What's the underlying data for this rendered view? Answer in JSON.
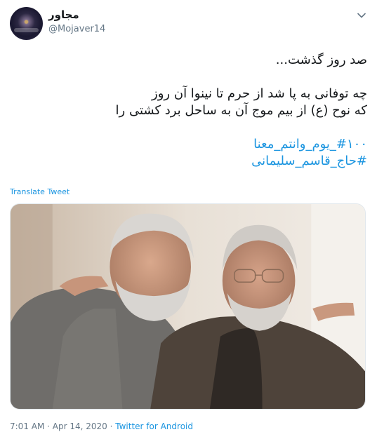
{
  "author": {
    "display_name": "مجاور",
    "handle": "@Mojaver14",
    "avatar_icon": "avatar-image"
  },
  "tweet": {
    "lines": [
      "صد روز گذشت...",
      "",
      "چه توفانی به پا شد از حرم تا نینوا آن روز",
      "که نوح (ع) از بیم موج آن به ساحل برد کشتی را",
      ""
    ],
    "hashtags": [
      "#۱۰۰_یوم_وانتم_معنا",
      "#حاج_قاسم_سلیمانی"
    ],
    "translate_label": "Translate Tweet"
  },
  "photo": {
    "icon": "photo-two-men-embracing"
  },
  "meta": {
    "time": "7:01 AM",
    "separator": " · ",
    "date": "Apr 14, 2020",
    "source": "Twitter for Android"
  },
  "colors": {
    "link": "#1b95e0",
    "secondary_text": "#657786",
    "primary_text": "#14171a"
  }
}
